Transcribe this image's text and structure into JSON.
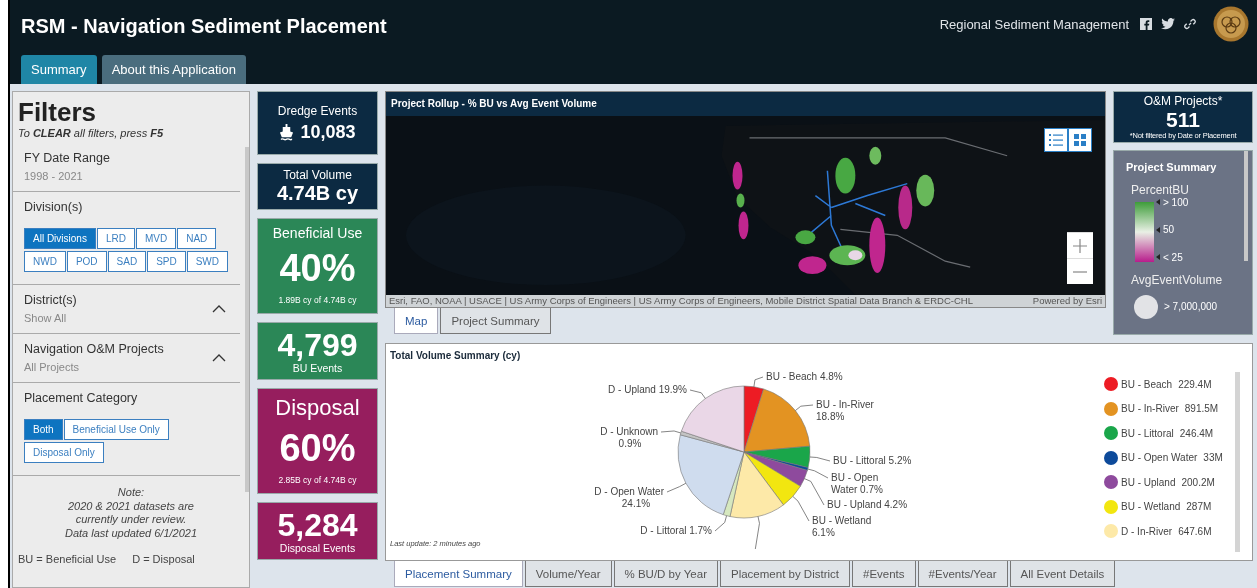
{
  "header": {
    "title": "RSM - Navigation Sediment Placement",
    "site_name": "Regional Sediment Management"
  },
  "tabs": [
    {
      "label": "Summary",
      "selected": true
    },
    {
      "label": "About this Application",
      "selected": false
    }
  ],
  "filters": {
    "title": "Filters",
    "hint": "To **CLEAR** all filters, press **F5**",
    "sections": [
      {
        "kind": "range",
        "label": "FY Date Range",
        "value": "1998 - 2021"
      },
      {
        "kind": "buttons",
        "label": "Division(s)",
        "options": [
          {
            "label": "All Divisions",
            "selected": true
          },
          {
            "label": "LRD",
            "selected": false
          },
          {
            "label": "MVD",
            "selected": false
          },
          {
            "label": "NAD",
            "selected": false
          },
          {
            "label": "NWD",
            "selected": false
          },
          {
            "label": "POD",
            "selected": false
          },
          {
            "label": "SAD",
            "selected": false
          },
          {
            "label": "SPD",
            "selected": false
          },
          {
            "label": "SWD",
            "selected": false
          }
        ]
      },
      {
        "kind": "dropdown",
        "label": "District(s)",
        "value": "Show All",
        "expanded": true
      },
      {
        "kind": "dropdown",
        "label": "Navigation O&M Projects",
        "value": "All Projects",
        "expanded": true
      },
      {
        "kind": "buttons",
        "label": "Placement Category",
        "options": [
          {
            "label": "Both",
            "selected": true
          },
          {
            "label": "Beneficial Use Only",
            "selected": false
          },
          {
            "label": "Disposal Only",
            "selected": false
          }
        ]
      }
    ],
    "note": [
      "Note:",
      "2020 & 2021 datasets are",
      "currently under review.",
      "Data last updated 6/1/2021"
    ],
    "abbreviations": [
      "BU = Beneficial Use",
      "D = Disposal"
    ]
  },
  "stats": [
    {
      "kind": "icon-count",
      "label": "Dredge Events",
      "value": "10,083",
      "color": "#0c2a42"
    },
    {
      "kind": "total",
      "label": "Total Volume",
      "value": "4.74B cy",
      "color": "#0c2a42"
    },
    {
      "kind": "percent",
      "label": "Beneficial Use",
      "value": "40%",
      "detail": "1.89B cy of 4.74B cy",
      "color": "#2b8757"
    },
    {
      "kind": "count",
      "label": "BU Events",
      "value": "4,799",
      "color": "#2b8757"
    },
    {
      "kind": "percent",
      "label": "Disposal",
      "value": "60%",
      "detail": "2.85B cy of 4.74B cy",
      "color": "#961e5e"
    },
    {
      "kind": "count",
      "label": "Disposal Events",
      "value": "5,284",
      "color": "#961e5e"
    }
  ],
  "map": {
    "title": "Project Rollup - % BU vs Avg Event Volume",
    "attribution": "Esri, FAO, NOAA | USACE | US Army Corps of Engineers | US Army Corps of Engineers, Mobile District Spatial Data Branch & ERDC-CHL",
    "powered_by": "Powered by Esri",
    "tabs": [
      {
        "label": "Map",
        "selected": true
      },
      {
        "label": "Project Summary",
        "selected": false
      }
    ]
  },
  "om_projects": {
    "label": "O&M Projects*",
    "value": "511",
    "footnote": "*Not filtered by Date or Placement"
  },
  "project_summary": {
    "title": "Project Summary",
    "percent_label": "PercentBU",
    "ticks": [
      "> 100",
      "50",
      "< 25"
    ],
    "size_label": "AvgEventVolume",
    "size_value": "> 7,000,000"
  },
  "volume_chart": {
    "title": "Total Volume Summary (cy)",
    "chart_data": {
      "type": "pie",
      "categories": [
        "BU - Beach",
        "BU - In-River",
        "BU - Littoral",
        "BU - Open Water",
        "BU - Upland",
        "BU - Wetland",
        null,
        "D - Littoral",
        "D - Open Water",
        "D - Unknown",
        "D - Upland"
      ],
      "series": [
        {
          "values": [
            4.8,
            18.8,
            5.2,
            0.7,
            4.2,
            6.1,
            13.6,
            1.7,
            24.1,
            0.9,
            19.9
          ]
        }
      ],
      "colors": [
        "#ed1c24",
        "#e39322",
        "#1aa64a",
        "#0d4a9a",
        "#8e4a9d",
        "#f2e610",
        "#fde9a8",
        "#d6e8bf",
        "#cfdcee",
        "#c4c4c4",
        "#ead7e7"
      ],
      "value_labels": [
        "4.8%",
        "18.8%",
        "5.2%",
        "0.7%",
        "4.2%",
        "6.1%",
        null,
        "1.7%",
        "24.1%",
        "0.9%",
        "19.9%"
      ]
    },
    "legend": [
      {
        "label": "BU - Beach",
        "value": "229.4M",
        "color": "#ed1c24"
      },
      {
        "label": "BU - In-River",
        "value": "891.5M",
        "color": "#e39322"
      },
      {
        "label": "BU - Littoral",
        "value": "246.4M",
        "color": "#1aa64a"
      },
      {
        "label": "BU - Open Water",
        "value": "33M",
        "color": "#0d4a9a"
      },
      {
        "label": "BU - Upland",
        "value": "200.2M",
        "color": "#8e4a9d"
      },
      {
        "label": "BU - Wetland",
        "value": "287M",
        "color": "#f2e610"
      },
      {
        "label": "D - In-River",
        "value": "647.6M",
        "color": "#fde9a8"
      }
    ],
    "last_update": "Last update: 2 minutes ago",
    "tabs": [
      {
        "label": "Placement Summary",
        "selected": true
      },
      {
        "label": "Volume/Year",
        "selected": false
      },
      {
        "label": "% BU/D by Year",
        "selected": false
      },
      {
        "label": "Placement by District",
        "selected": false
      },
      {
        "label": "#Events",
        "selected": false
      },
      {
        "label": "#Events/Year",
        "selected": false
      },
      {
        "label": "All Event Details",
        "selected": false
      }
    ]
  }
}
